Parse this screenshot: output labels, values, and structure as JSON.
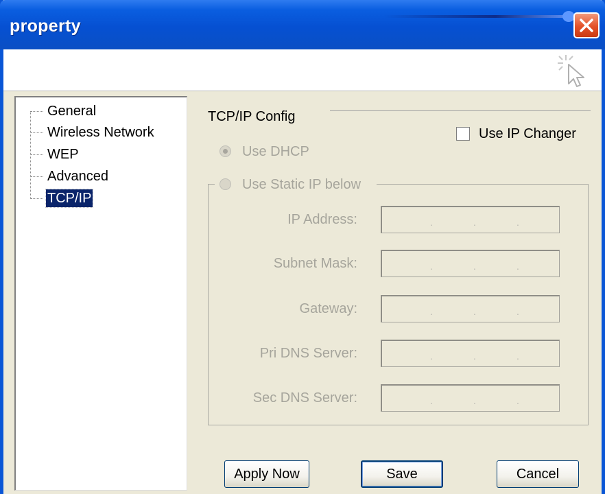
{
  "window": {
    "title": "property"
  },
  "tree": {
    "items": [
      {
        "label": "General",
        "selected": false
      },
      {
        "label": "Wireless Network",
        "selected": false
      },
      {
        "label": "WEP",
        "selected": false
      },
      {
        "label": "Advanced",
        "selected": false
      },
      {
        "label": "TCP/IP",
        "selected": true
      }
    ]
  },
  "tcpip": {
    "group_label": "TCP/IP Config",
    "use_ip_changer": {
      "label": "Use IP Changer",
      "checked": false
    },
    "use_dhcp": {
      "label": "Use DHCP",
      "selected": true,
      "enabled": false
    },
    "use_static": {
      "label": "Use Static IP below",
      "selected": false,
      "enabled": false
    },
    "fields": [
      {
        "label": "IP Address:",
        "value": ". . ."
      },
      {
        "label": "Subnet Mask:",
        "value": ". . ."
      },
      {
        "label": "Gateway:",
        "value": ". . ."
      },
      {
        "label": "Pri DNS Server:",
        "value": ". . ."
      },
      {
        "label": "Sec DNS Server:",
        "value": ". . ."
      }
    ]
  },
  "buttons": {
    "apply": "Apply Now",
    "save": "Save",
    "cancel": "Cancel"
  },
  "colors": {
    "titlebar": "#0650d2",
    "window_bg": "#ece9d8",
    "selection": "#0a246a",
    "close_button": "#e45129"
  }
}
